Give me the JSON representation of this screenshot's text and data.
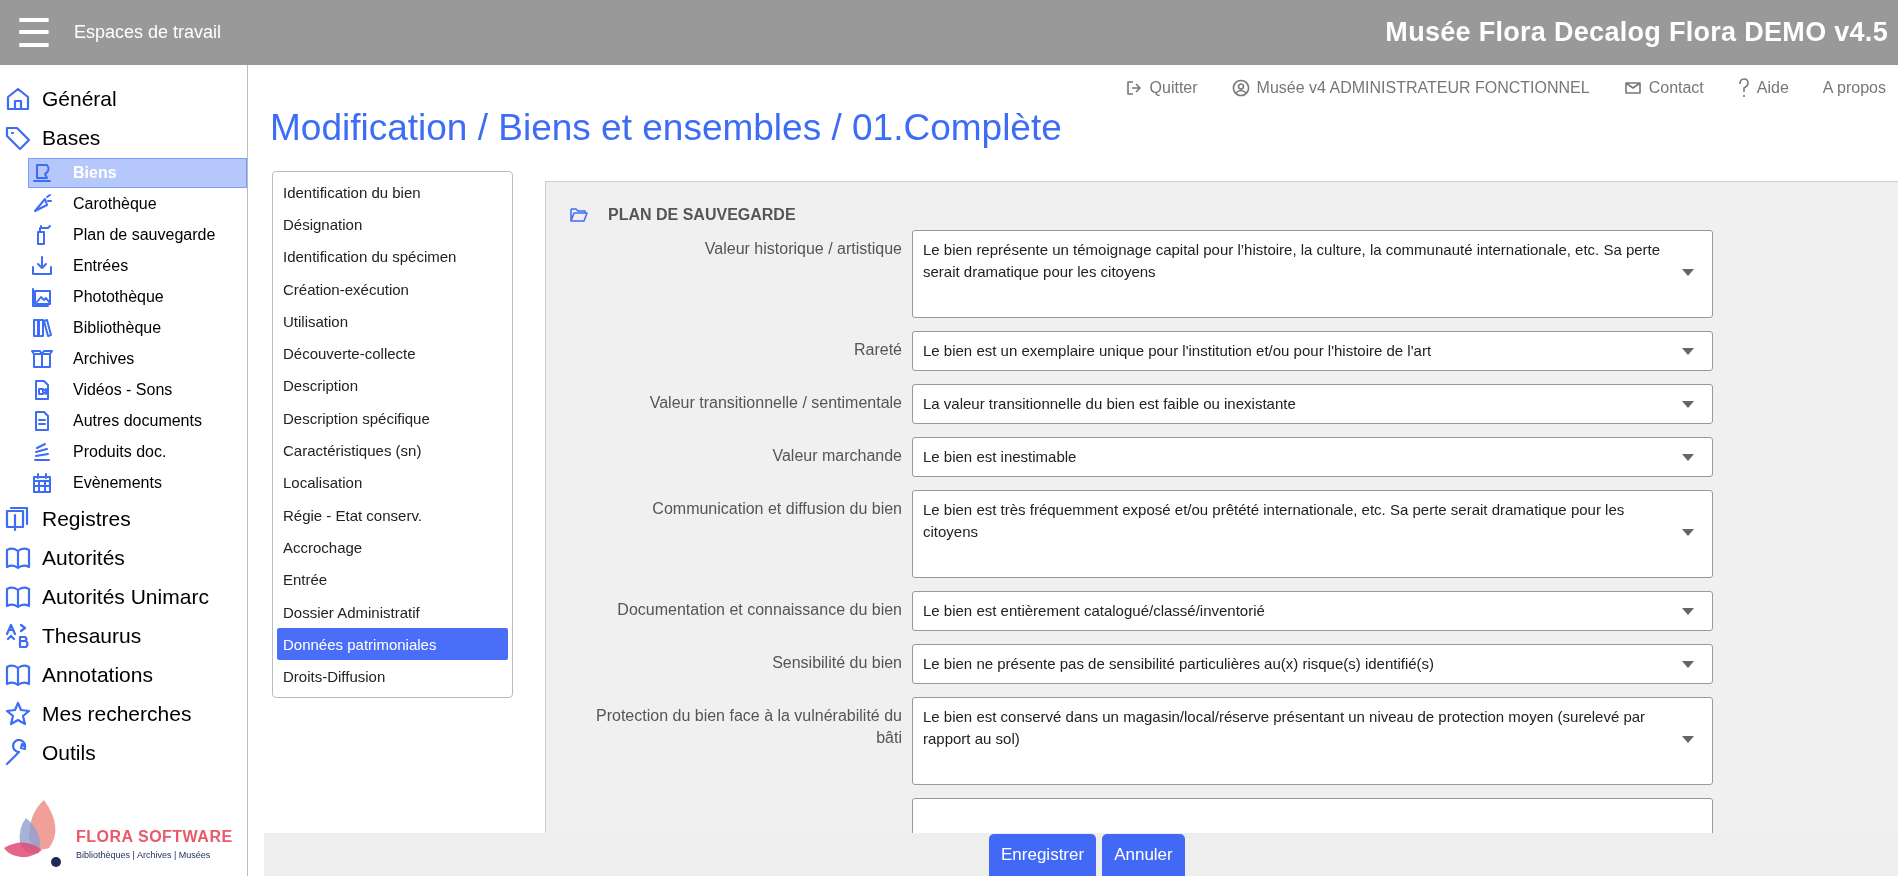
{
  "topbar": {
    "menu_icon": "☰",
    "workspaces": "Espaces de travail",
    "app_title": "Musée Flora Decalog Flora DEMO v4.5"
  },
  "sidebar": {
    "items": [
      {
        "label": "Général",
        "selected": false
      },
      {
        "label": "Bases",
        "selected": false,
        "children": [
          {
            "label": "Biens",
            "selected": true
          },
          {
            "label": "Carothèque",
            "selected": false
          },
          {
            "label": "Plan de sauvegarde",
            "selected": false
          },
          {
            "label": "Entrées",
            "selected": false
          },
          {
            "label": "Photothèque",
            "selected": false
          },
          {
            "label": "Bibliothèque",
            "selected": false
          },
          {
            "label": "Archives",
            "selected": false
          },
          {
            "label": "Vidéos - Sons",
            "selected": false
          },
          {
            "label": "Autres documents",
            "selected": false
          },
          {
            "label": "Produits doc.",
            "selected": false
          },
          {
            "label": "Evènements",
            "selected": false
          }
        ]
      },
      {
        "label": "Registres",
        "selected": false
      },
      {
        "label": "Autorités",
        "selected": false
      },
      {
        "label": "Autorités Unimarc",
        "selected": false
      },
      {
        "label": "Thesaurus",
        "selected": false
      },
      {
        "label": "Annotations",
        "selected": false
      },
      {
        "label": "Mes recherches",
        "selected": false
      },
      {
        "label": "Outils",
        "selected": false
      }
    ],
    "logo": {
      "name": "FLORA SOFTWARE",
      "tagline": "Bibliothèques | Archives | Musées"
    }
  },
  "header_links": [
    {
      "kind": "logout",
      "label": "Quitter"
    },
    {
      "kind": "user",
      "label": "Musée v4 ADMINISTRATEUR FONCTIONNEL"
    },
    {
      "kind": "mail",
      "label": "Contact"
    },
    {
      "kind": "help",
      "label": "Aide"
    },
    {
      "kind": "about",
      "label": "A propos"
    }
  ],
  "page_title": "Modification / Biens et ensembles / 01.Complète",
  "sections": [
    {
      "label": "Identification du bien",
      "selected": false
    },
    {
      "label": "Désignation",
      "selected": false
    },
    {
      "label": "Identification du spécimen",
      "selected": false
    },
    {
      "label": "Création-exécution",
      "selected": false
    },
    {
      "label": "Utilisation",
      "selected": false
    },
    {
      "label": "Découverte-collecte",
      "selected": false
    },
    {
      "label": "Description",
      "selected": false
    },
    {
      "label": "Description spécifique",
      "selected": false
    },
    {
      "label": "Caractéristiques (sn)",
      "selected": false
    },
    {
      "label": "Localisation",
      "selected": false
    },
    {
      "label": "Régie - Etat conserv.",
      "selected": false
    },
    {
      "label": "Accrochage",
      "selected": false
    },
    {
      "label": "Entrée",
      "selected": false
    },
    {
      "label": "Dossier Administratif",
      "selected": false
    },
    {
      "label": "Données patrimoniales",
      "selected": true
    },
    {
      "label": "Droits-Diffusion",
      "selected": false
    }
  ],
  "form": {
    "heading": "PLAN DE SAUVEGARDE",
    "fields": [
      {
        "label": "Valeur historique / artistique",
        "value": "Le bien représente un témoignage capital pour l’histoire, la culture, la communauté internationale, etc. Sa perte serait dramatique pour les citoyens",
        "multiline": true
      },
      {
        "label": "Rareté",
        "value": "Le bien est un exemplaire unique pour l'institution et/ou pour l'histoire de l'art",
        "multiline": false
      },
      {
        "label": "Valeur transitionnelle / sentimentale",
        "value": "La valeur transitionnelle du bien est faible ou inexistante",
        "multiline": false
      },
      {
        "label": "Valeur marchande",
        "value": "Le bien est inestimable",
        "multiline": false
      },
      {
        "label": "Communication et diffusion du bien",
        "value": "Le bien est très fréquemment exposé et/ou prêtété internationale, etc. Sa perte serait dramatique pour les citoyens",
        "multiline": true
      },
      {
        "label": "Documentation et connaissance du bien",
        "value": "Le bien est entièrement catalogué/classé/inventorié",
        "multiline": false
      },
      {
        "label": "Sensibilité du bien",
        "value": "Le bien ne présente pas de sensibilité particulières au(x) risque(s) identifié(s)",
        "multiline": false
      },
      {
        "label": "Protection du bien face à la vulnérabilité du bâti",
        "value": "Le bien est conservé dans un magasin/local/réserve présentant un niveau de protection moyen (surelevé par rapport au sol)",
        "multiline": true
      }
    ]
  },
  "buttons": [
    "Enregistrer",
    "Annuler"
  ]
}
